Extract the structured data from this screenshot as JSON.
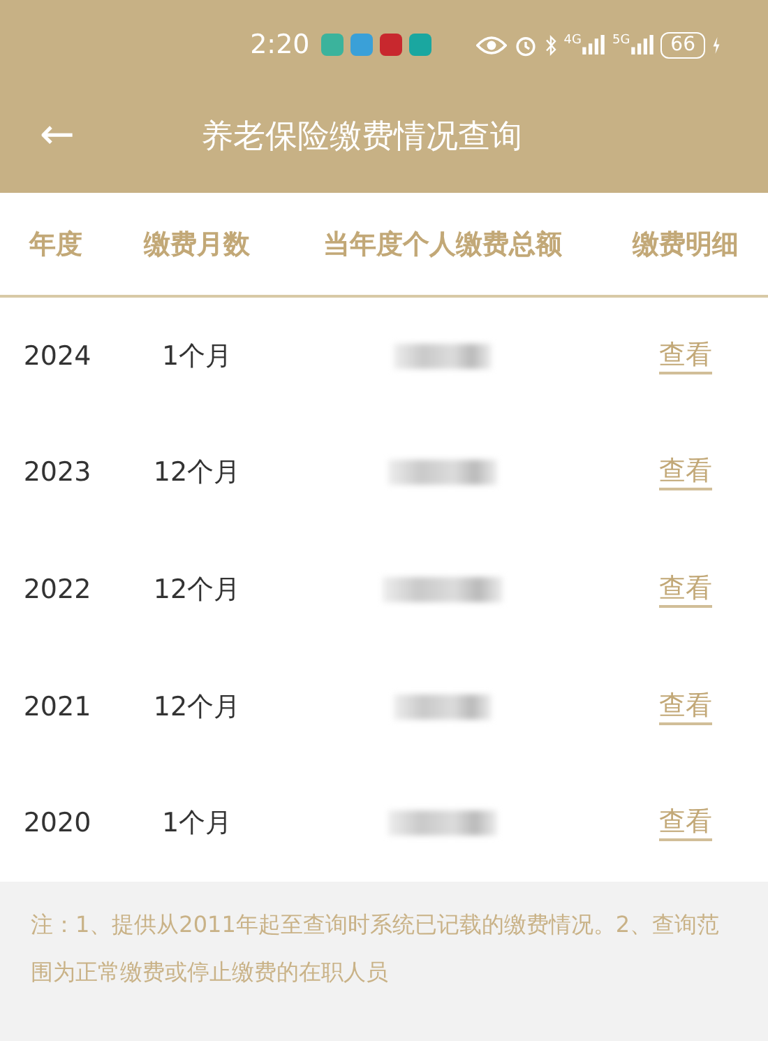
{
  "status_bar": {
    "time": "2:20",
    "network_1": "4G",
    "network_2": "5G",
    "battery": "66"
  },
  "header": {
    "back_icon": "←",
    "title": "养老保险缴费情况查询"
  },
  "table": {
    "columns": [
      "年度",
      "缴费月数",
      "当年度个人缴费总额",
      "缴费明细"
    ],
    "rows": [
      {
        "year": "2024",
        "months": "1个月",
        "link": "查看"
      },
      {
        "year": "2023",
        "months": "12个月",
        "link": "查看"
      },
      {
        "year": "2022",
        "months": "12个月",
        "link": "查看"
      },
      {
        "year": "2021",
        "months": "12个月",
        "link": "查看"
      },
      {
        "year": "2020",
        "months": "1个月",
        "link": "查看"
      }
    ]
  },
  "note": "注：1、提供从2011年起至查询时系统已记载的缴费情况。2、查询范围为正常缴费或停止缴费的在职人员"
}
